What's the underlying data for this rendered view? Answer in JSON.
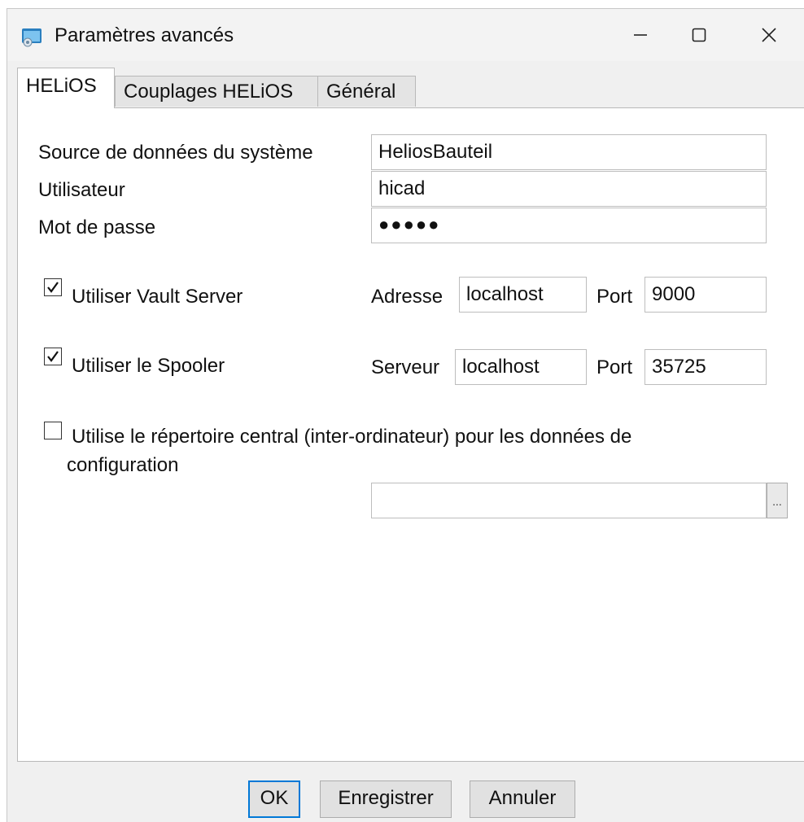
{
  "window": {
    "title": "Paramètres avancés",
    "icon": "app-window-icon",
    "controls": {
      "minimize": "minimize-icon",
      "maximize": "maximize-icon",
      "close": "close-icon"
    }
  },
  "tabs": [
    {
      "label": "HELiOS",
      "active": true
    },
    {
      "label": "Couplages HELiOS",
      "active": false
    },
    {
      "label": "Général",
      "active": false
    }
  ],
  "form": {
    "data_source": {
      "label": "Source de données du système",
      "value": "HeliosBauteil"
    },
    "user": {
      "label": "Utilisateur",
      "value": "hicad"
    },
    "password": {
      "label": "Mot de passe",
      "value": "●●●●●"
    },
    "vault": {
      "checkbox_label": "Utiliser Vault Server",
      "checked": true,
      "address_label": "Adresse",
      "address_value": "localhost",
      "port_label": "Port",
      "port_value": "9000"
    },
    "spooler": {
      "checkbox_label": "Utiliser le Spooler",
      "checked": true,
      "server_label": "Serveur",
      "server_value": "localhost",
      "port_label": "Port",
      "port_value": "35725"
    },
    "central_dir": {
      "checkbox_label_line1": "Utilise le répertoire central (inter-ordinateur) pour les données de",
      "checkbox_label_line2": "configuration",
      "checked": false,
      "path_value": "",
      "browse_label": "..."
    }
  },
  "buttons": {
    "ok": "OK",
    "save": "Enregistrer",
    "cancel": "Annuler"
  },
  "colors": {
    "accent": "#0078d7",
    "panel": "#ffffff",
    "chrome": "#f0f0f0"
  }
}
